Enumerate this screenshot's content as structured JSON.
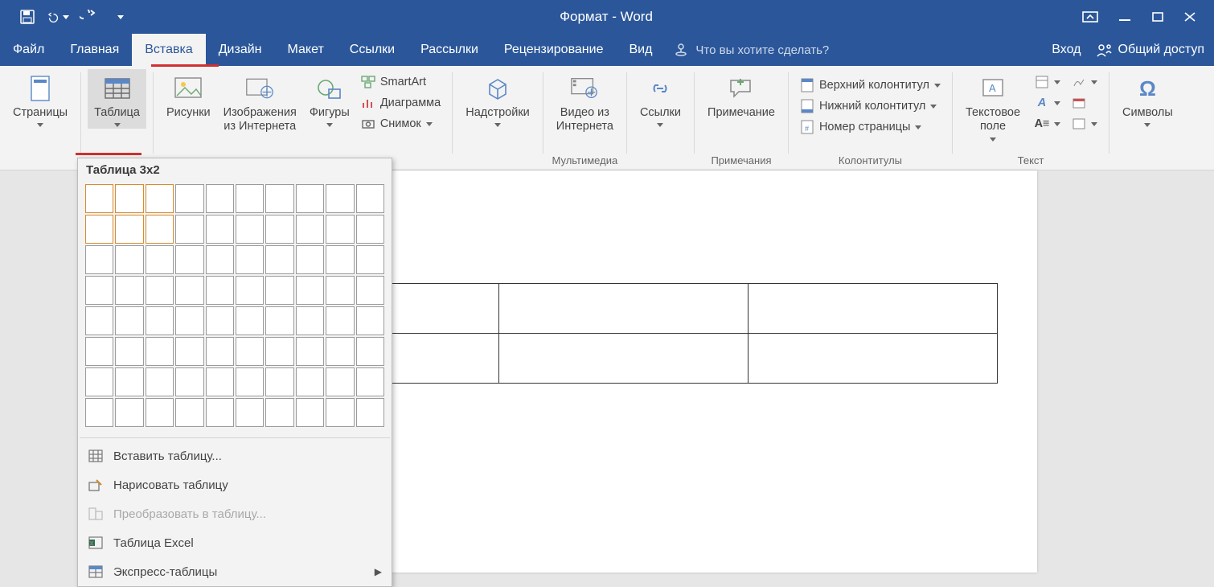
{
  "titlebar": {
    "title": "Формат - Word"
  },
  "account": {
    "login": "Вход",
    "share": "Общий доступ"
  },
  "tabs": {
    "file": "Файл",
    "home": "Главная",
    "insert": "Вставка",
    "design": "Дизайн",
    "layout": "Макет",
    "references": "Ссылки",
    "mailings": "Рассылки",
    "review": "Рецензирование",
    "view": "Вид"
  },
  "tell_me_placeholder": "Что вы хотите сделать?",
  "ribbon": {
    "pages": {
      "label": "Страницы"
    },
    "table": {
      "label": "Таблица"
    },
    "pictures": {
      "label": "Рисунки"
    },
    "online_pictures_l1": "Изображения",
    "online_pictures_l2": "из Интернета",
    "shapes": {
      "label": "Фигуры"
    },
    "smartart": "SmartArt",
    "chart": "Диаграмма",
    "screenshot": "Снимок",
    "addins": "Надстройки",
    "video_l1": "Видео из",
    "video_l2": "Интернета",
    "media_group": "Мультимедиа",
    "links": "Ссылки",
    "comment": "Примечание",
    "comments_group": "Примечания",
    "header": "Верхний колонтитул",
    "footer": "Нижний колонтитул",
    "page_number": "Номер страницы",
    "hf_group": "Колонтитулы",
    "textbox_l1": "Текстовое",
    "textbox_l2": "поле",
    "text_group": "Текст",
    "symbols": "Символы"
  },
  "dropdown": {
    "header": "Таблица 3x2",
    "grid_cols": 10,
    "grid_rows": 8,
    "sel_cols": 3,
    "sel_rows": 2,
    "insert_table": "Вставить таблицу...",
    "draw_table": "Нарисовать таблицу",
    "convert": "Преобразовать в таблицу...",
    "excel": "Таблица Excel",
    "quick": "Экспресс-таблицы"
  }
}
